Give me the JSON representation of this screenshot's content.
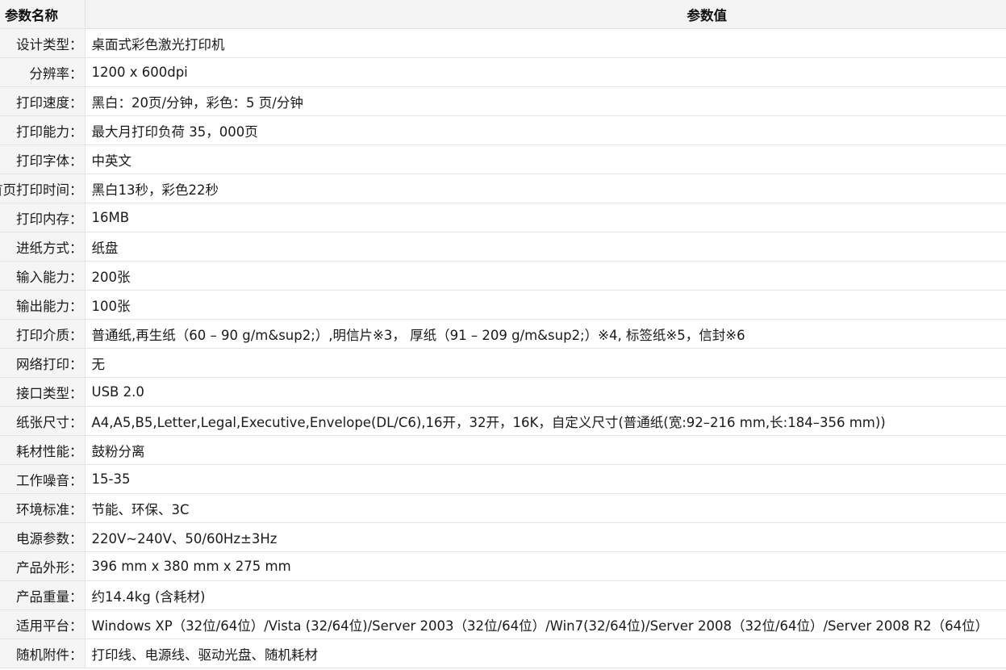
{
  "header": {
    "name_col": "参数名称",
    "value_col": "参数值"
  },
  "rows": [
    {
      "name": "设计类型：",
      "value": "桌面式彩色激光打印机"
    },
    {
      "name": "分辨率：",
      "value": "1200 x 600dpi"
    },
    {
      "name": "打印速度：",
      "value": "黑白：20页/分钟，彩色：5 页/分钟"
    },
    {
      "name": "打印能力：",
      "value": "最大月打印负荷 35，000页"
    },
    {
      "name": "打印字体：",
      "value": "中英文"
    },
    {
      "name": "首页打印时间：",
      "value": "黑白13秒，彩色22秒"
    },
    {
      "name": "打印内存：",
      "value": "16MB"
    },
    {
      "name": "进纸方式：",
      "value": "纸盘"
    },
    {
      "name": "输入能力：",
      "value": "200张"
    },
    {
      "name": "输出能力：",
      "value": "100张"
    },
    {
      "name": "打印介质：",
      "value": "普通纸,再生纸（60 – 90 g/m&sup2;）,明信片※3， 厚纸（91 – 209 g/m&sup2;）※4, 标签纸※5，信封※6"
    },
    {
      "name": "网络打印：",
      "value": "无"
    },
    {
      "name": "接口类型：",
      "value": "USB 2.0"
    },
    {
      "name": "纸张尺寸：",
      "value": "A4,A5,B5,Letter,Legal,Executive,Envelope(DL/C6),16开，32开，16K，自定义尺寸(普通纸(宽:92–216 mm,长:184–356 mm))"
    },
    {
      "name": "耗材性能：",
      "value": "鼓粉分离"
    },
    {
      "name": "工作噪音：",
      "value": "15-35"
    },
    {
      "name": "环境标准：",
      "value": "节能、环保、3C"
    },
    {
      "name": "电源参数：",
      "value": "220V~240V、50/60Hz±3Hz"
    },
    {
      "name": "产品外形：",
      "value": "396 mm x 380 mm x 275 mm"
    },
    {
      "name": "产品重量：",
      "value": "约14.4kg (含耗材)"
    },
    {
      "name": "适用平台：",
      "value": "Windows XP（32位/64位）/Vista (32/64位)/Server 2003（32位/64位）/Win7(32/64位)/Server 2008（32位/64位）/Server 2008 R2（64位）"
    },
    {
      "name": "随机附件：",
      "value": "打印线、电源线、驱动光盘、随机耗材"
    }
  ]
}
